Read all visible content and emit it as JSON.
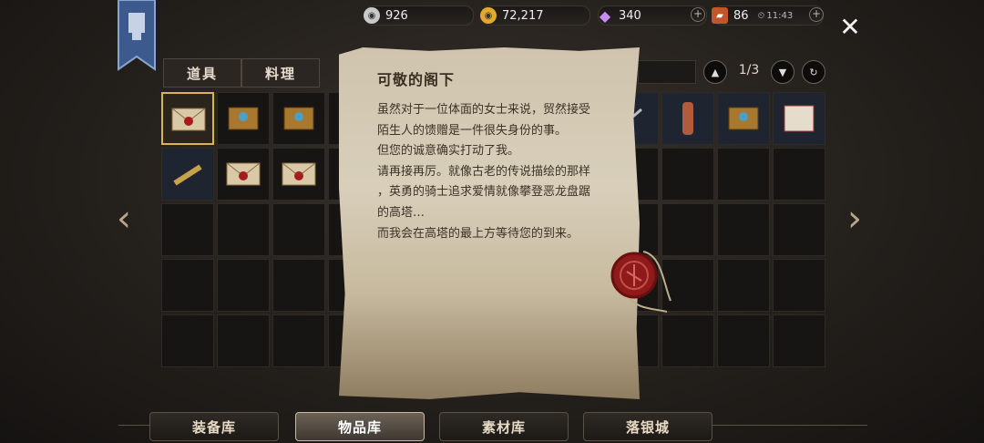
{
  "currency": {
    "silver": "926",
    "gold": "72,217",
    "gems": "340",
    "tickets": "86",
    "time": "11:43"
  },
  "tabs": [
    "道具",
    "料理"
  ],
  "pager": {
    "text": "1/3"
  },
  "letter": {
    "title": "可敬的阁下",
    "body": "虽然对于一位体面的女士来说，贸然接受\n陌生人的馈赠是一件很失身份的事。\n但您的诚意确实打动了我。\n请再接再厉。就像古老的传说描绘的那样\n，英勇的骑士追求爱情就像攀登恶龙盘踞\n的高塔…\n而我会在高塔的最上方等待您的到来。"
  },
  "bottom_tabs": [
    "装备库",
    "物品库",
    "素材库",
    "落银城"
  ],
  "colors": {
    "accent_gold": "#d9b357",
    "paper": "#d8cfbb",
    "seal": "#8e1a1a"
  }
}
